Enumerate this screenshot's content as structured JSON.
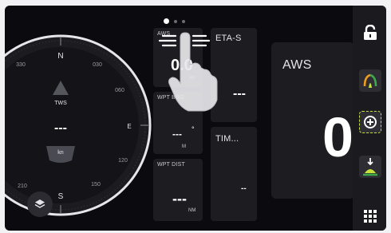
{
  "compass": {
    "north": "N",
    "south": "S",
    "east": "E",
    "ticks": [
      "330",
      "030",
      "060",
      "120",
      "150",
      "210"
    ],
    "tws_label": "TWS",
    "tws_value": "---",
    "tws_unit": "kn"
  },
  "tiles": {
    "aws_small": {
      "label": "AWS",
      "value": "0.0",
      "unit": "kn"
    },
    "eta": {
      "label": "ETA-S",
      "value": "---"
    },
    "wpt_brg": {
      "label": "WPT BRG",
      "value": "---",
      "unit": "M"
    },
    "tim": {
      "label": "TIM...",
      "value": "--"
    },
    "wpt_dist": {
      "label": "WPT DIST",
      "value": "---",
      "unit": "NM"
    },
    "aws_big": {
      "label": "AWS",
      "value": "0"
    }
  },
  "pagination": {
    "pages": 3,
    "active": 1
  },
  "rail": {
    "icons": [
      "lock-icon",
      "sails-icon",
      "zoom-in-icon",
      "anchor-drop-icon",
      "apps-grid-icon"
    ]
  },
  "colors": {
    "accent_yellow": "#c6e33a",
    "accent_orange": "#f29c1f",
    "accent_green": "#3ea84a"
  }
}
